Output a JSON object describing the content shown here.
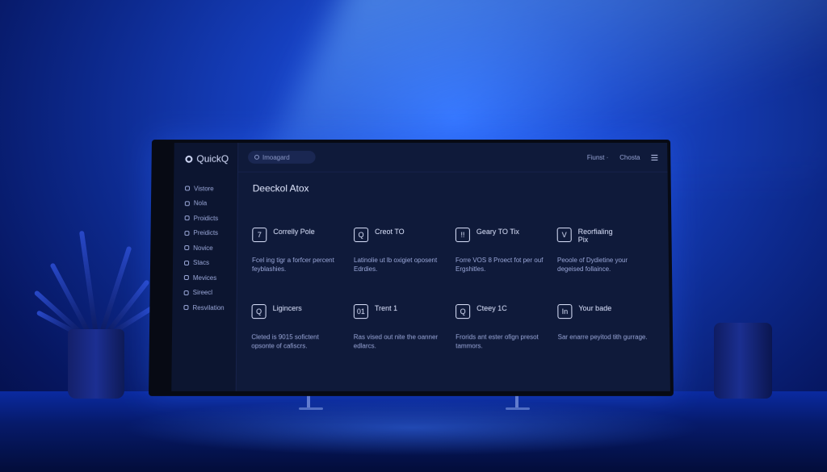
{
  "app": {
    "name": "QuickQ"
  },
  "search": {
    "placeholder": "Imoagard"
  },
  "topbar": {
    "item1": "Fiunst ·",
    "item2": "Chosta"
  },
  "sidebar": {
    "items": [
      {
        "label": "Vistore",
        "icon": "store-icon"
      },
      {
        "label": "Nola",
        "icon": "note-icon"
      },
      {
        "label": "Proidicts",
        "icon": "products-icon"
      },
      {
        "label": "Preidicts",
        "icon": "predict-icon"
      },
      {
        "label": "Novice",
        "icon": "service-icon"
      },
      {
        "label": "Stacs",
        "icon": "stack-icon"
      },
      {
        "label": "Mevices",
        "icon": "devices-icon"
      },
      {
        "label": "Sireecl",
        "icon": "speed-icon"
      },
      {
        "label": "Resvilation",
        "icon": "resolution-icon"
      }
    ]
  },
  "main": {
    "heading": "Deeckol Atox",
    "cards": [
      {
        "glyph": "7",
        "title": "Correlly Pole",
        "desc": "Fcel ing tigr a forfcer percent feyblashies."
      },
      {
        "glyph": "Q",
        "title": "Creot TO",
        "desc": "Latinolie ut lb oxigiet oposent Edrdies."
      },
      {
        "glyph": "!!",
        "title": "Geary TO Tix",
        "desc": "Forre VOS 8 Proect fot per ouf Ergshitles."
      },
      {
        "glyph": "V",
        "title": "Reorfialing Pix",
        "desc": "Peoole of Dydietine your degeised follaince."
      },
      {
        "glyph": "Q",
        "title": "Ligincers",
        "desc": "Cleted is 9015 sofictent opsonte of cafiscrs."
      },
      {
        "glyph": "01",
        "title": "Trent 1",
        "desc": "Ras vised out nite the oanner edlarcs."
      },
      {
        "glyph": "Q",
        "title": "Cteey 1C",
        "desc": "Frorids ant ester ofign presot tammors."
      },
      {
        "glyph": "In",
        "title": "Your bade",
        "desc": "Sar enarre peyitod tith gurrage."
      }
    ]
  }
}
